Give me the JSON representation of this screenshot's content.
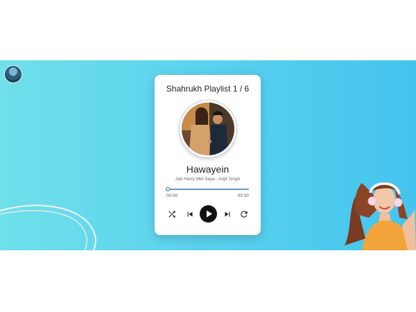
{
  "playlist": {
    "title": "Shahrukh Playlist 1 / 6"
  },
  "song": {
    "title": "Hawayein",
    "artist": "Jab Harry Met Sejal - Arijit Singh"
  },
  "progress": {
    "current_time": "00:00",
    "total_time": "00:30",
    "fraction": 0
  },
  "controls": {
    "shuffle_icon": "shuffle-icon",
    "prev_icon": "skip-previous-icon",
    "play_icon": "play-icon",
    "next_icon": "skip-next-icon",
    "repeat_icon": "repeat-icon"
  },
  "colors": {
    "background_start": "#6fe0ea",
    "background_end": "#44c4ee",
    "progress": "#2f62b8",
    "play_button": "#111111"
  }
}
